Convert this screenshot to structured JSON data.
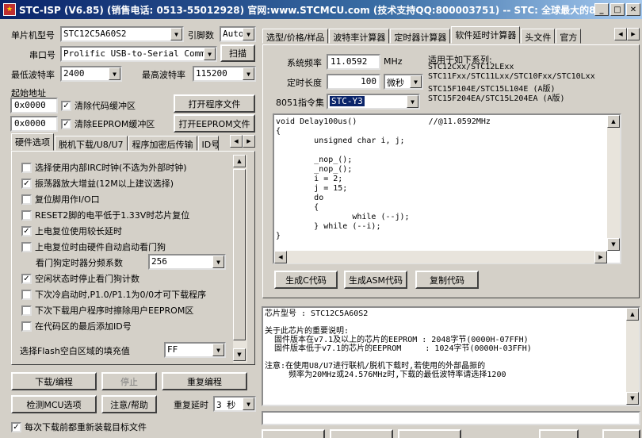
{
  "window": {
    "title": "STC-ISP (V6.85) (销售电话: 0513-55012928) 官网:www.STCMCU.com (技术支持QQ:800003751) -- STC: 全球最大的8051单片机..."
  },
  "left": {
    "mcu_type_label": "单片机型号",
    "mcu_type_value": "STC12C5A60S2",
    "pin_label": "引脚数",
    "pin_value": "Auto",
    "port_label": "串口号",
    "port_value": "Prolific USB-to-Serial Comm Po",
    "scan_button": "扫描",
    "min_baud_label": "最低波特率",
    "min_baud_value": "2400",
    "max_baud_label": "最高波特率",
    "max_baud_value": "115200",
    "start_addr_label": "起始地址",
    "addr1": "0x0000",
    "addr2": "0x0000",
    "clear_code_label": "清除代码缓冲区",
    "clear_eeprom_label": "清除EEPROM缓冲区",
    "open_prog_button": "打开程序文件",
    "open_eeprom_button": "打开EEPROM文件",
    "tabs": [
      "硬件选项",
      "脱机下载/U8/U7",
      "程序加密后传输",
      "ID号"
    ],
    "options": [
      {
        "label": "选择使用内部IRC时钟(不选为外部时钟)",
        "checked": ""
      },
      {
        "label": "振荡器放大增益(12M以上建议选择)",
        "checked": "✓"
      },
      {
        "label": "复位脚用作I/O口",
        "checked": ""
      },
      {
        "label": "RESET2脚的电平低于1.33V时芯片复位",
        "checked": ""
      },
      {
        "label": "上电复位使用较长延时",
        "checked": "✓"
      },
      {
        "label": "上电复位时由硬件自动启动看门狗",
        "checked": ""
      }
    ],
    "wdt_label": "看门狗定时器分频系数",
    "wdt_value": "256",
    "options2": [
      {
        "label": "空闲状态时停止看门狗计数",
        "checked": "✓"
      },
      {
        "label": "下次冷启动时,P1.0/P1.1为0/0才可下载程序",
        "checked": ""
      },
      {
        "label": "下次下载用户程序时擦除用户EEPROM区",
        "checked": ""
      },
      {
        "label": "在代码区的最后添加ID号",
        "checked": ""
      }
    ],
    "fill_label": "选择Flash空白区域的填充值",
    "fill_value": "FF",
    "download_button": "下载/编程",
    "stop_button": "停止",
    "reprogram_button": "重复编程",
    "detect_button": "检测MCU选项",
    "help_button": "注意/帮助",
    "repeat_delay_label": "重复延时",
    "repeat_delay_value": "3 秒",
    "reload_label": "每次下载前都重新装载目标文件"
  },
  "right": {
    "tabs": [
      "选型/价格/样品",
      "波特率计算器",
      "定时器计算器",
      "软件延时计算器",
      "头文件",
      "官方"
    ],
    "freq_label": "系统频率",
    "freq_value": "11.0592",
    "freq_unit": "MHz",
    "delay_label": "定时长度",
    "delay_value": "100",
    "delay_unit": "微秒",
    "isa_label": "8051指令集",
    "isa_value": "STC-Y3",
    "applies_label": "适用于如下系列:",
    "applies_lines": [
      "STC12Cxx/STC12LExx",
      "STC11Fxx/STC11Lxx/STC10Fxx/STC10Lxx",
      "STC15F104E/STC15L104E (A版)",
      "STC15F204EA/STC15L204EA (A版)"
    ],
    "code": "void Delay100us()\t\t//@11.0592MHz\n{\n\tunsigned char i, j;\n\n\t_nop_();\n\t_nop_();\n\ti = 2;\n\tj = 15;\n\tdo\n\t{\n\t\twhile (--j);\n\t} while (--i);\n}",
    "gen_c_button": "生成C代码",
    "gen_asm_button": "生成ASM代码",
    "copy_button": "复制代码",
    "info": "芯片型号 : STC12C5A60S2\n\n关于此芯片的重要说明:\n  固件版本在v7.1及以上的芯片的EEPROM : 2048字节(0000H-07FFH)\n  固件版本低于v7.1的芯片的EEPROM     : 1024字节(0000H-03FFH)\n\n注意:在使用U8/U7进行联机/脱机下载时,若使用的外部晶振的\n     频率为20MHz或24.576MHz时,下载的最低波特率请选择1200"
  }
}
